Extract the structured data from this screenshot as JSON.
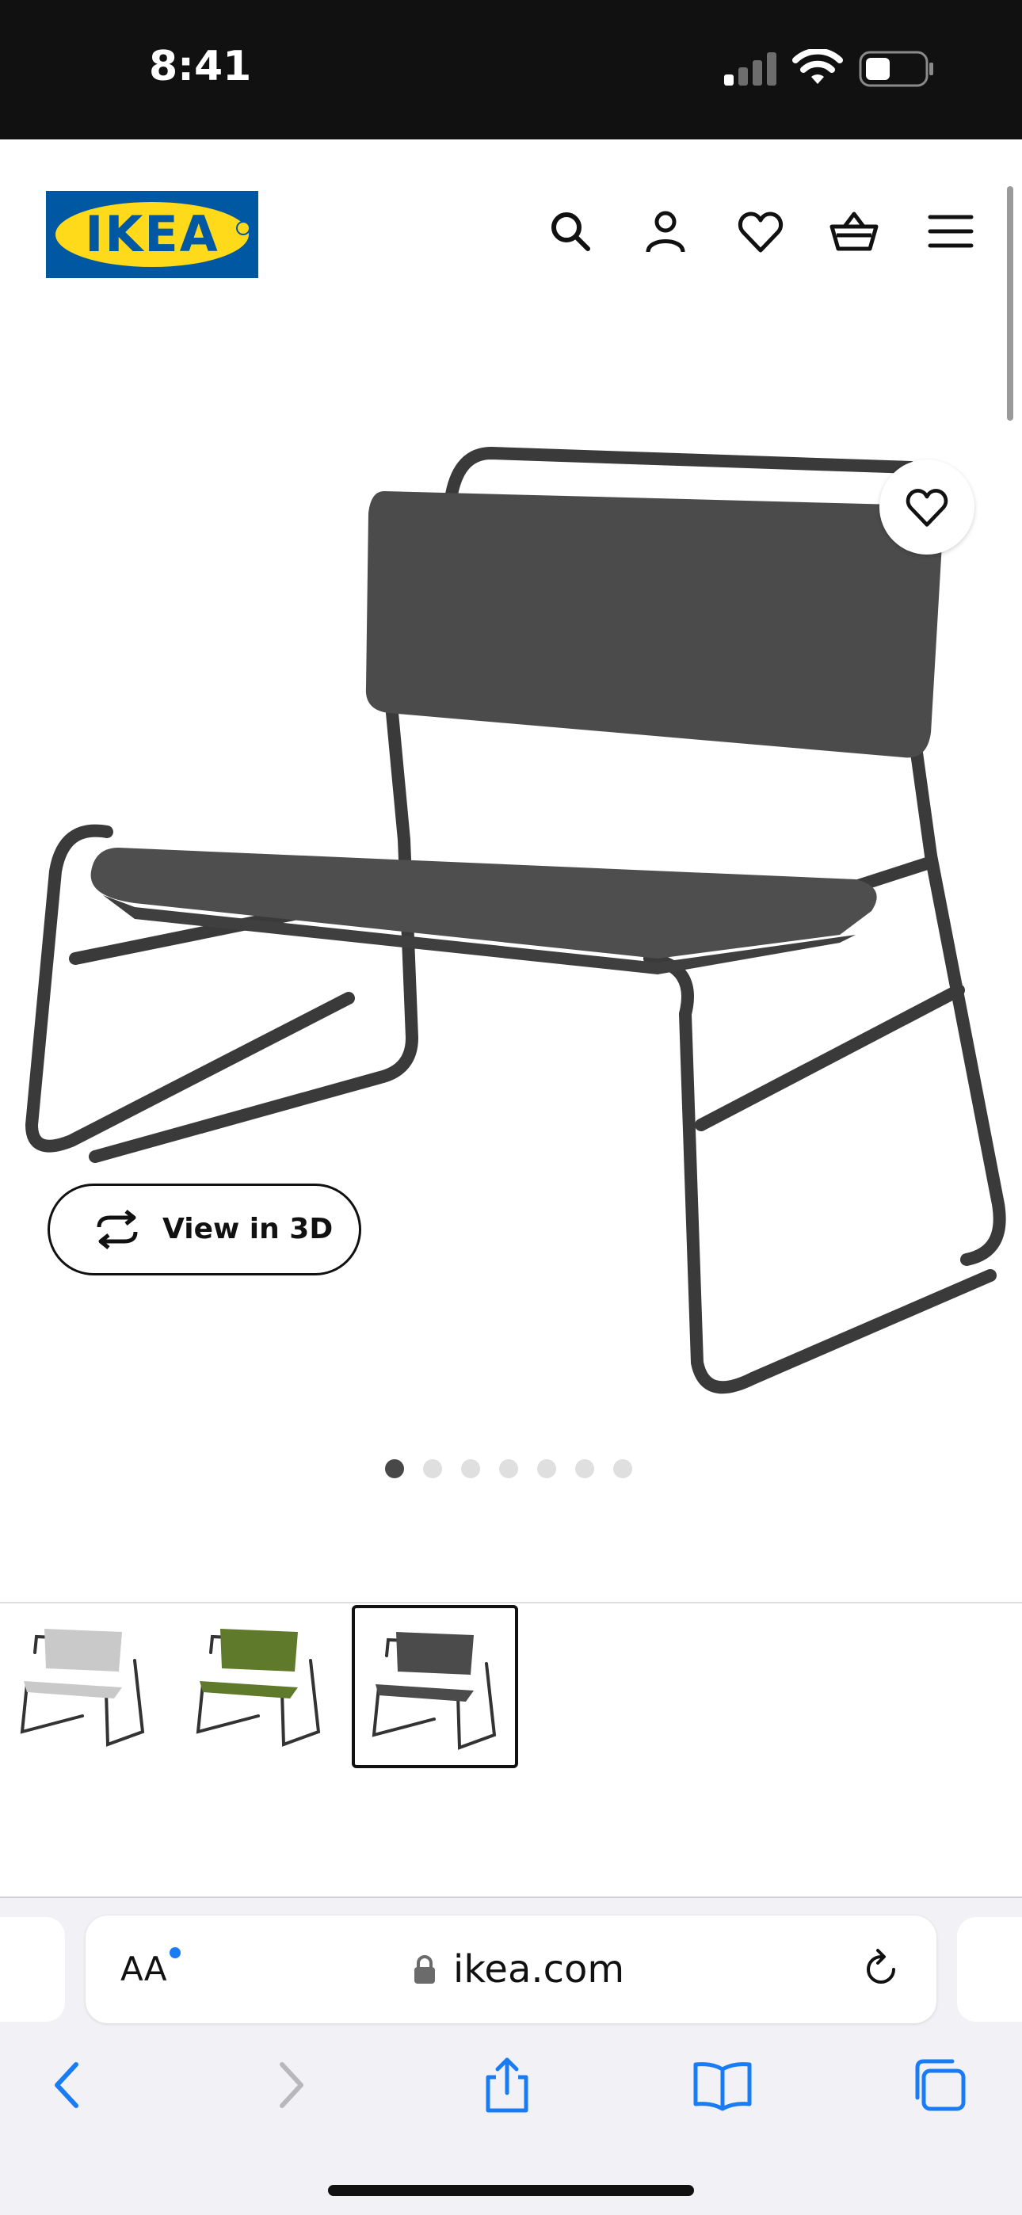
{
  "status_bar": {
    "time": "8:41",
    "bg": "#111111"
  },
  "header": {
    "logo_text": "IKEA",
    "logo_colors": {
      "blue": "#0058a3",
      "yellow": "#ffda1a"
    },
    "icons": [
      "search-icon",
      "account-icon",
      "heart-icon",
      "basket-icon",
      "menu-icon"
    ]
  },
  "product": {
    "image_alt": "Dark grey lounge chair with black metal frame",
    "favorite_icon": "heart-icon",
    "view_3d_label": "View in 3D",
    "carousel": {
      "total": 7,
      "active_index": 0
    }
  },
  "variants": {
    "items": [
      {
        "name": "light-grey",
        "color": "#c9c9c9",
        "selected": false
      },
      {
        "name": "green",
        "color": "#5e7a2a",
        "selected": false
      },
      {
        "name": "dark-grey",
        "color": "#4b4b4b",
        "selected": true
      }
    ]
  },
  "safari": {
    "aa_label": "AA",
    "url": "ikea.com",
    "toolbar_icons": [
      "back-icon",
      "forward-icon",
      "share-icon",
      "bookmarks-icon",
      "tabs-icon"
    ],
    "accent": "#1a7cf5"
  }
}
